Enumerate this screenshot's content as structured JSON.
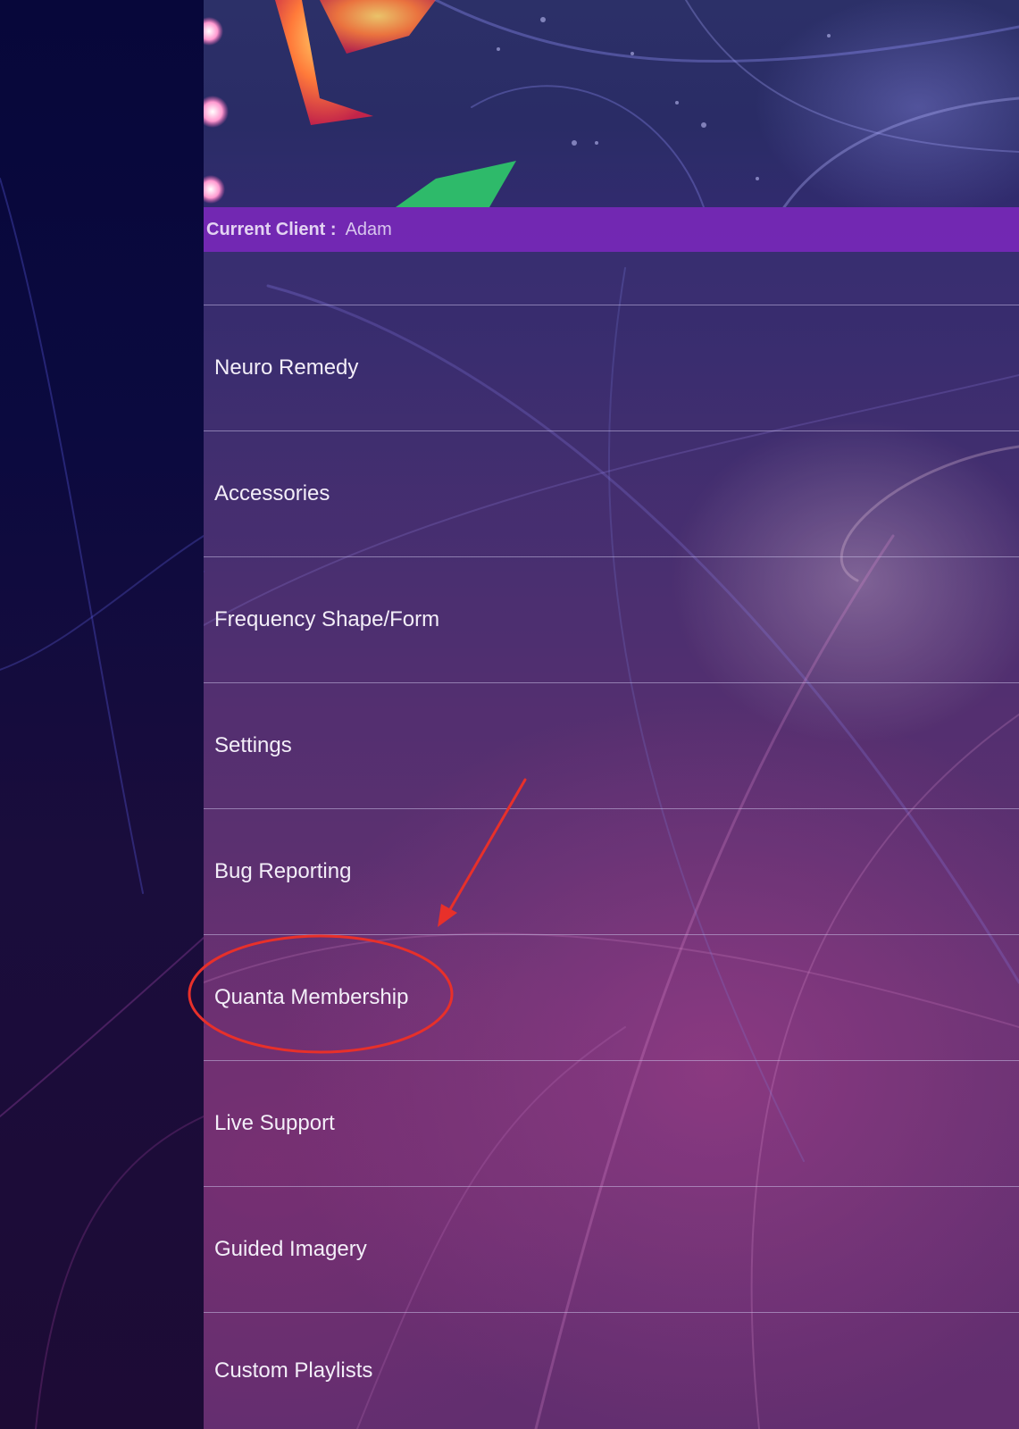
{
  "client_bar": {
    "label": "Current Client :",
    "value": "Adam"
  },
  "menu": {
    "items": [
      {
        "label": "Neuro Remedy"
      },
      {
        "label": "Accessories"
      },
      {
        "label": "Frequency Shape/Form"
      },
      {
        "label": "Settings"
      },
      {
        "label": "Bug Reporting"
      },
      {
        "label": "Quanta Membership"
      },
      {
        "label": "Live Support"
      },
      {
        "label": "Guided Imagery"
      },
      {
        "label": "Custom Playlists"
      }
    ],
    "highlighted_item": "Quanta Membership"
  },
  "colors": {
    "client_bar": "#7c28be",
    "annotation": "#e8302a",
    "left_strip": "#07073a"
  }
}
